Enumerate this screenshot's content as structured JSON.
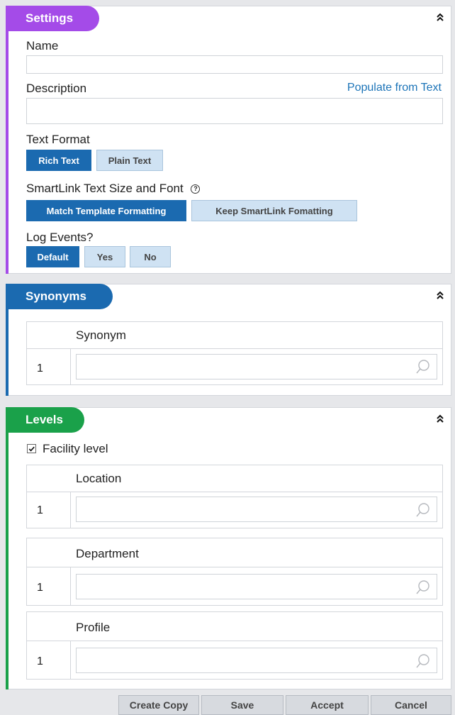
{
  "settings": {
    "title": "Settings",
    "accent_color": "#a44be8",
    "name_label": "Name",
    "name_value": "",
    "description_label": "Description",
    "description_value": "",
    "populate_link": "Populate from Text",
    "text_format_label": "Text Format",
    "text_format_options": [
      "Rich Text",
      "Plain Text"
    ],
    "text_format_selected": "Rich Text",
    "smartlink_label": "SmartLink Text Size and Font",
    "smartlink_options": [
      "Match Template Formatting",
      "Keep SmartLink Fomatting"
    ],
    "smartlink_selected": "Match Template Formatting",
    "log_events_label": "Log Events?",
    "log_events_options": [
      "Default",
      "Yes",
      "No"
    ],
    "log_events_selected": "Default"
  },
  "synonyms": {
    "title": "Synonyms",
    "accent_color": "#1b6ab0",
    "column_header": "Synonym",
    "rows": [
      {
        "index": "1",
        "value": ""
      }
    ]
  },
  "levels": {
    "title": "Levels",
    "accent_color": "#1aa14a",
    "facility_checkbox_label": "Facility level",
    "facility_checked": true,
    "tables": [
      {
        "header": "Location",
        "rows": [
          {
            "index": "1",
            "value": ""
          }
        ]
      },
      {
        "header": "Department",
        "rows": [
          {
            "index": "1",
            "value": ""
          }
        ]
      },
      {
        "header": "Profile",
        "rows": [
          {
            "index": "1",
            "value": ""
          }
        ]
      }
    ]
  },
  "footer": {
    "buttons": [
      "Create Copy",
      "Save",
      "Accept",
      "Cancel"
    ]
  },
  "icons": {
    "collapse": "double-chevron-up-icon",
    "search": "magnifier-icon",
    "help": "question-circle-icon",
    "check": "checkmark-icon"
  }
}
